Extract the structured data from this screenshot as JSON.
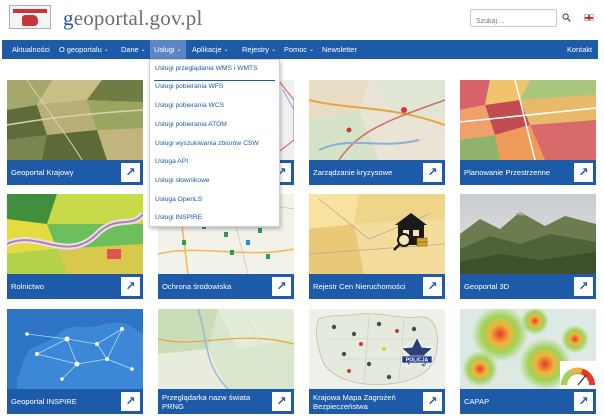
{
  "header": {
    "logo_text_prefix": "g",
    "logo_text_rest": "eoportal.gov.pl",
    "search_placeholder": "Szukaj ..."
  },
  "nav": {
    "items": [
      {
        "label": "Aktualności",
        "has_dropdown": false
      },
      {
        "label": "O geoportalu",
        "has_dropdown": true
      },
      {
        "label": "Dane",
        "has_dropdown": true
      },
      {
        "label": "Usługi",
        "has_dropdown": true,
        "active": true
      },
      {
        "label": "Aplikacje",
        "has_dropdown": true
      },
      {
        "label": "Rejestry",
        "has_dropdown": true
      },
      {
        "label": "Pomoc",
        "has_dropdown": true
      },
      {
        "label": "Newsletter",
        "has_dropdown": false
      },
      {
        "label": "Kontakt",
        "has_dropdown": false
      }
    ]
  },
  "dropdown": {
    "items": [
      "Usługi przeglądania WMS i WMTS",
      "Usługi pobierania WFS",
      "Usługi pobierania WCS",
      "Usługi pobierania ATOM",
      "Usługi wyszukiwania zbiorów CSW",
      "Usługa API",
      "Usługi słownikowe",
      "Usługa OpenLS",
      "Usługi INSPIRE"
    ]
  },
  "tiles": [
    {
      "label": "Geoportal Krajowy",
      "image": "aerial-fields"
    },
    {
      "label": "",
      "image": "map-partial"
    },
    {
      "label": "Zarządzanie kryzysowe",
      "image": "crisis-map"
    },
    {
      "label": "Planowanie Przestrzenne",
      "image": "zoning-map"
    },
    {
      "label": "Rolnictwo",
      "image": "agriculture-map"
    },
    {
      "label": "Ochrona środowiska",
      "image": "environment-map"
    },
    {
      "label": "Rejestr Cen Nieruchomości",
      "image": "real-estate-map"
    },
    {
      "label": "Geoportal 3D",
      "image": "terrain-3d"
    },
    {
      "label": "Geoportal INSPIRE",
      "image": "europe-network"
    },
    {
      "label": "Przeglądarka nazw świata PRNG",
      "image": "world-names-map"
    },
    {
      "label": "Krajowa Mapa Zagrożeń Bezpieczeństwa",
      "image": "police-map"
    },
    {
      "label": "CAPAP",
      "image": "heatmap"
    }
  ],
  "badge_text": "POLICJA",
  "colors": {
    "brand_blue": "#1d5ba8",
    "nav_active": "#5d86c4",
    "logo_red": "#c8343a"
  },
  "icons": {
    "tile_arrow": "arrow-up-right-icon",
    "search": "search-icon",
    "language": "english-flag-icon"
  }
}
